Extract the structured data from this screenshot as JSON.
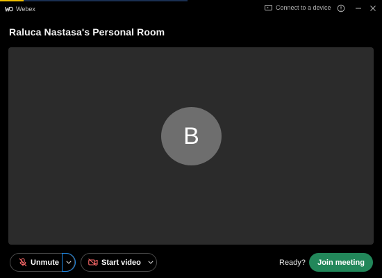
{
  "app": {
    "name": "Webex",
    "connect_label": "Connect to a device"
  },
  "room": {
    "title": "Raluca Nastasa's Personal Room"
  },
  "preview": {
    "avatar_initial": "B"
  },
  "controls": {
    "unmute_label": "Unmute",
    "video_label": "Start video",
    "ready_label": "Ready?",
    "join_label": "Join meeting"
  },
  "colors": {
    "background": "#000000",
    "preview": "#2b2b2b",
    "avatar": "#6e6e6e",
    "join": "#22875a",
    "unmute_icon": "#ff6b6b",
    "video_icon": "#ff6b6b",
    "focus_ring": "#1e88e5"
  },
  "icons": {
    "app_logo": "webex-logo-icon",
    "connect": "cast-device-icon",
    "help": "info-icon",
    "minimize": "minimize-icon",
    "close": "close-icon",
    "mic": "mic-muted-icon",
    "video": "video-off-icon",
    "dropdown": "chevron-down-icon"
  }
}
